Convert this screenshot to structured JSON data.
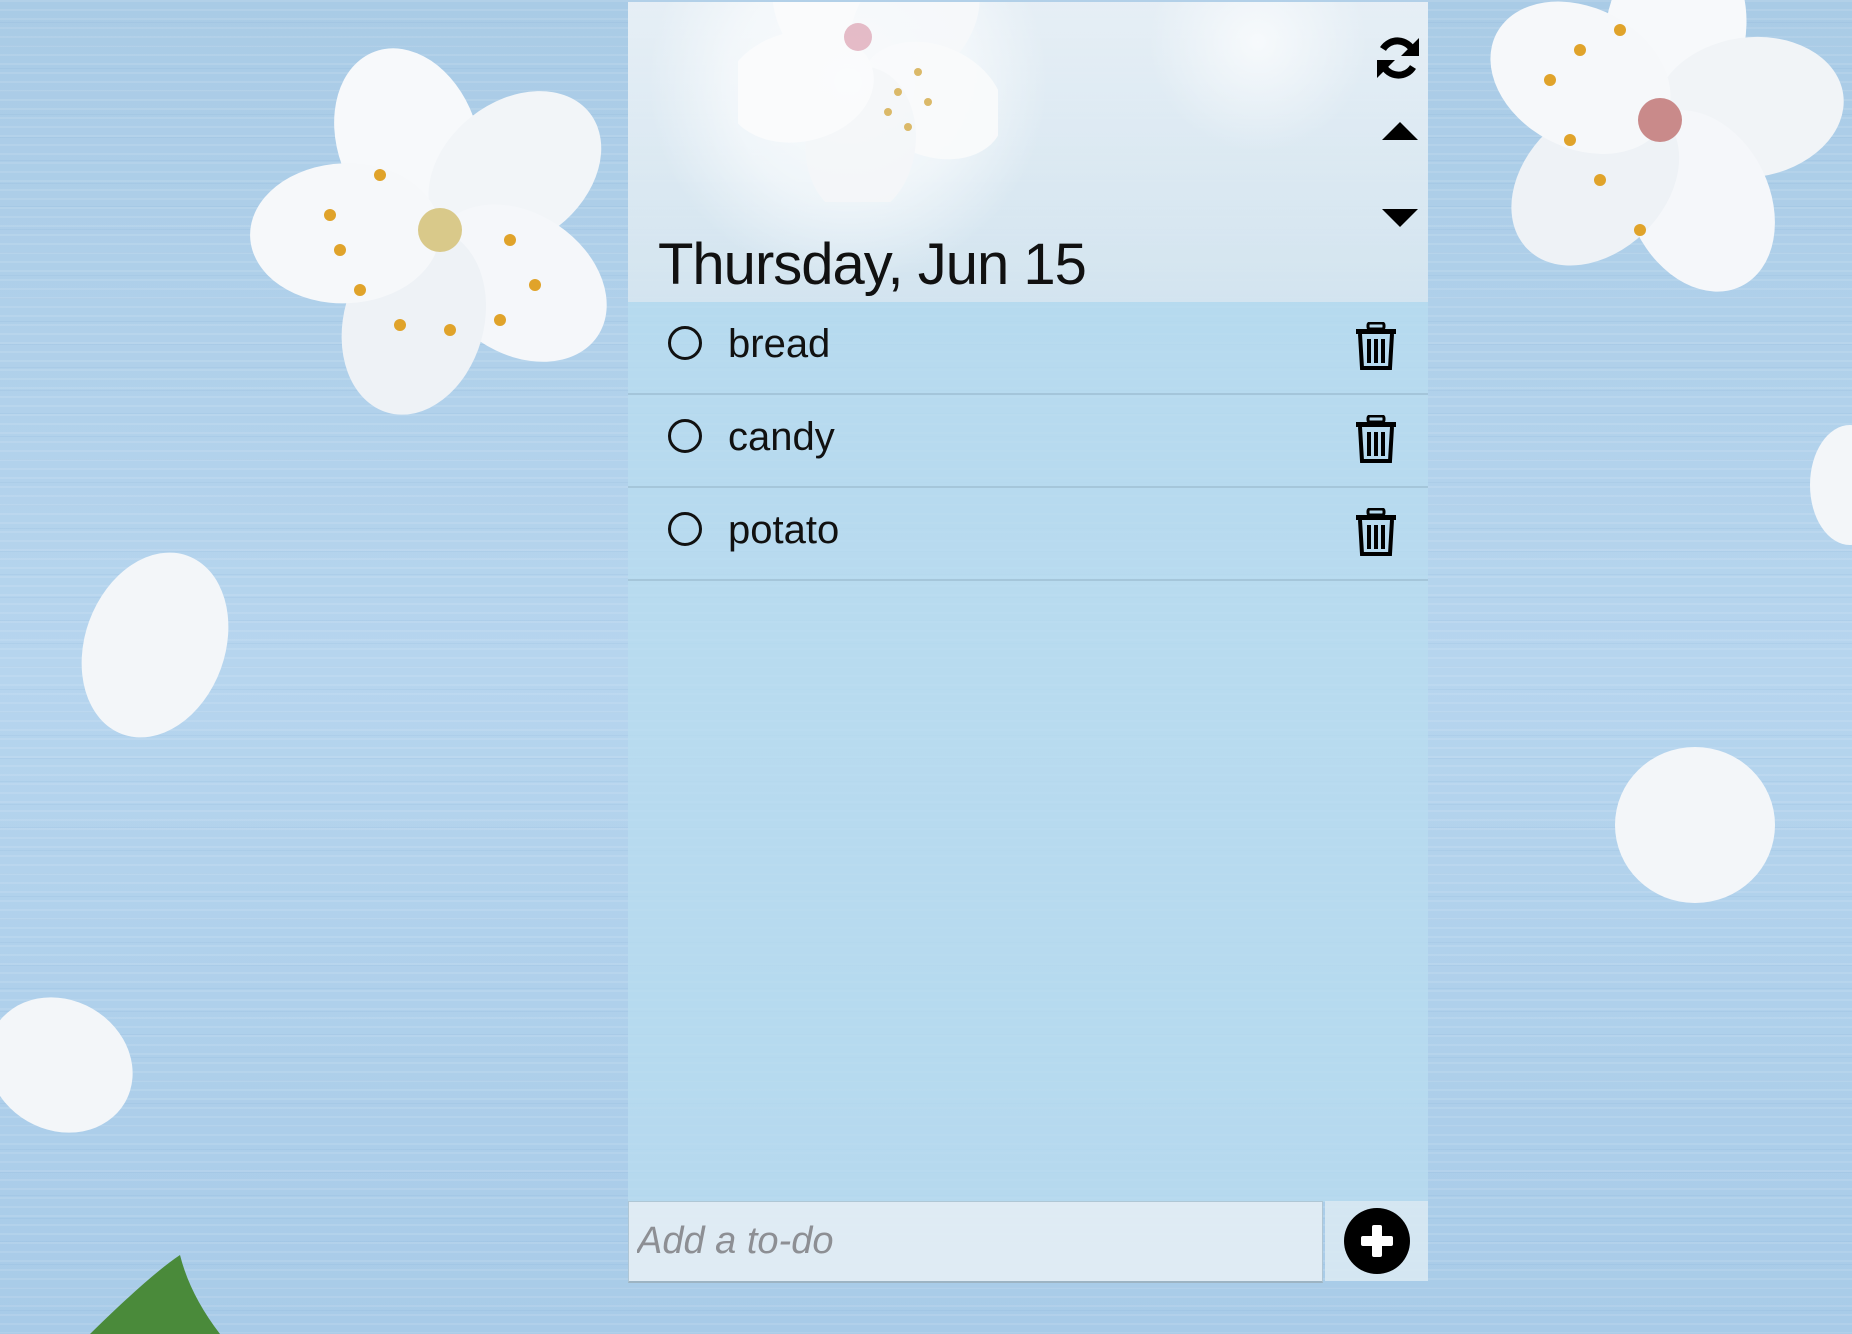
{
  "header": {
    "date_title": "Thursday, Jun 15",
    "refresh_icon": "refresh-icon",
    "up_icon": "caret-up-icon",
    "down_icon": "caret-down-icon"
  },
  "todos": [
    {
      "label": "bread",
      "completed": false
    },
    {
      "label": "candy",
      "completed": false
    },
    {
      "label": "potato",
      "completed": false
    }
  ],
  "add_bar": {
    "placeholder": "Add a to-do",
    "value": "",
    "add_icon": "plus-circle-icon"
  },
  "colors": {
    "background": "#b1d1ea",
    "list_background": "#b9ddf0",
    "text": "#111111",
    "placeholder": "#8d8f94"
  }
}
